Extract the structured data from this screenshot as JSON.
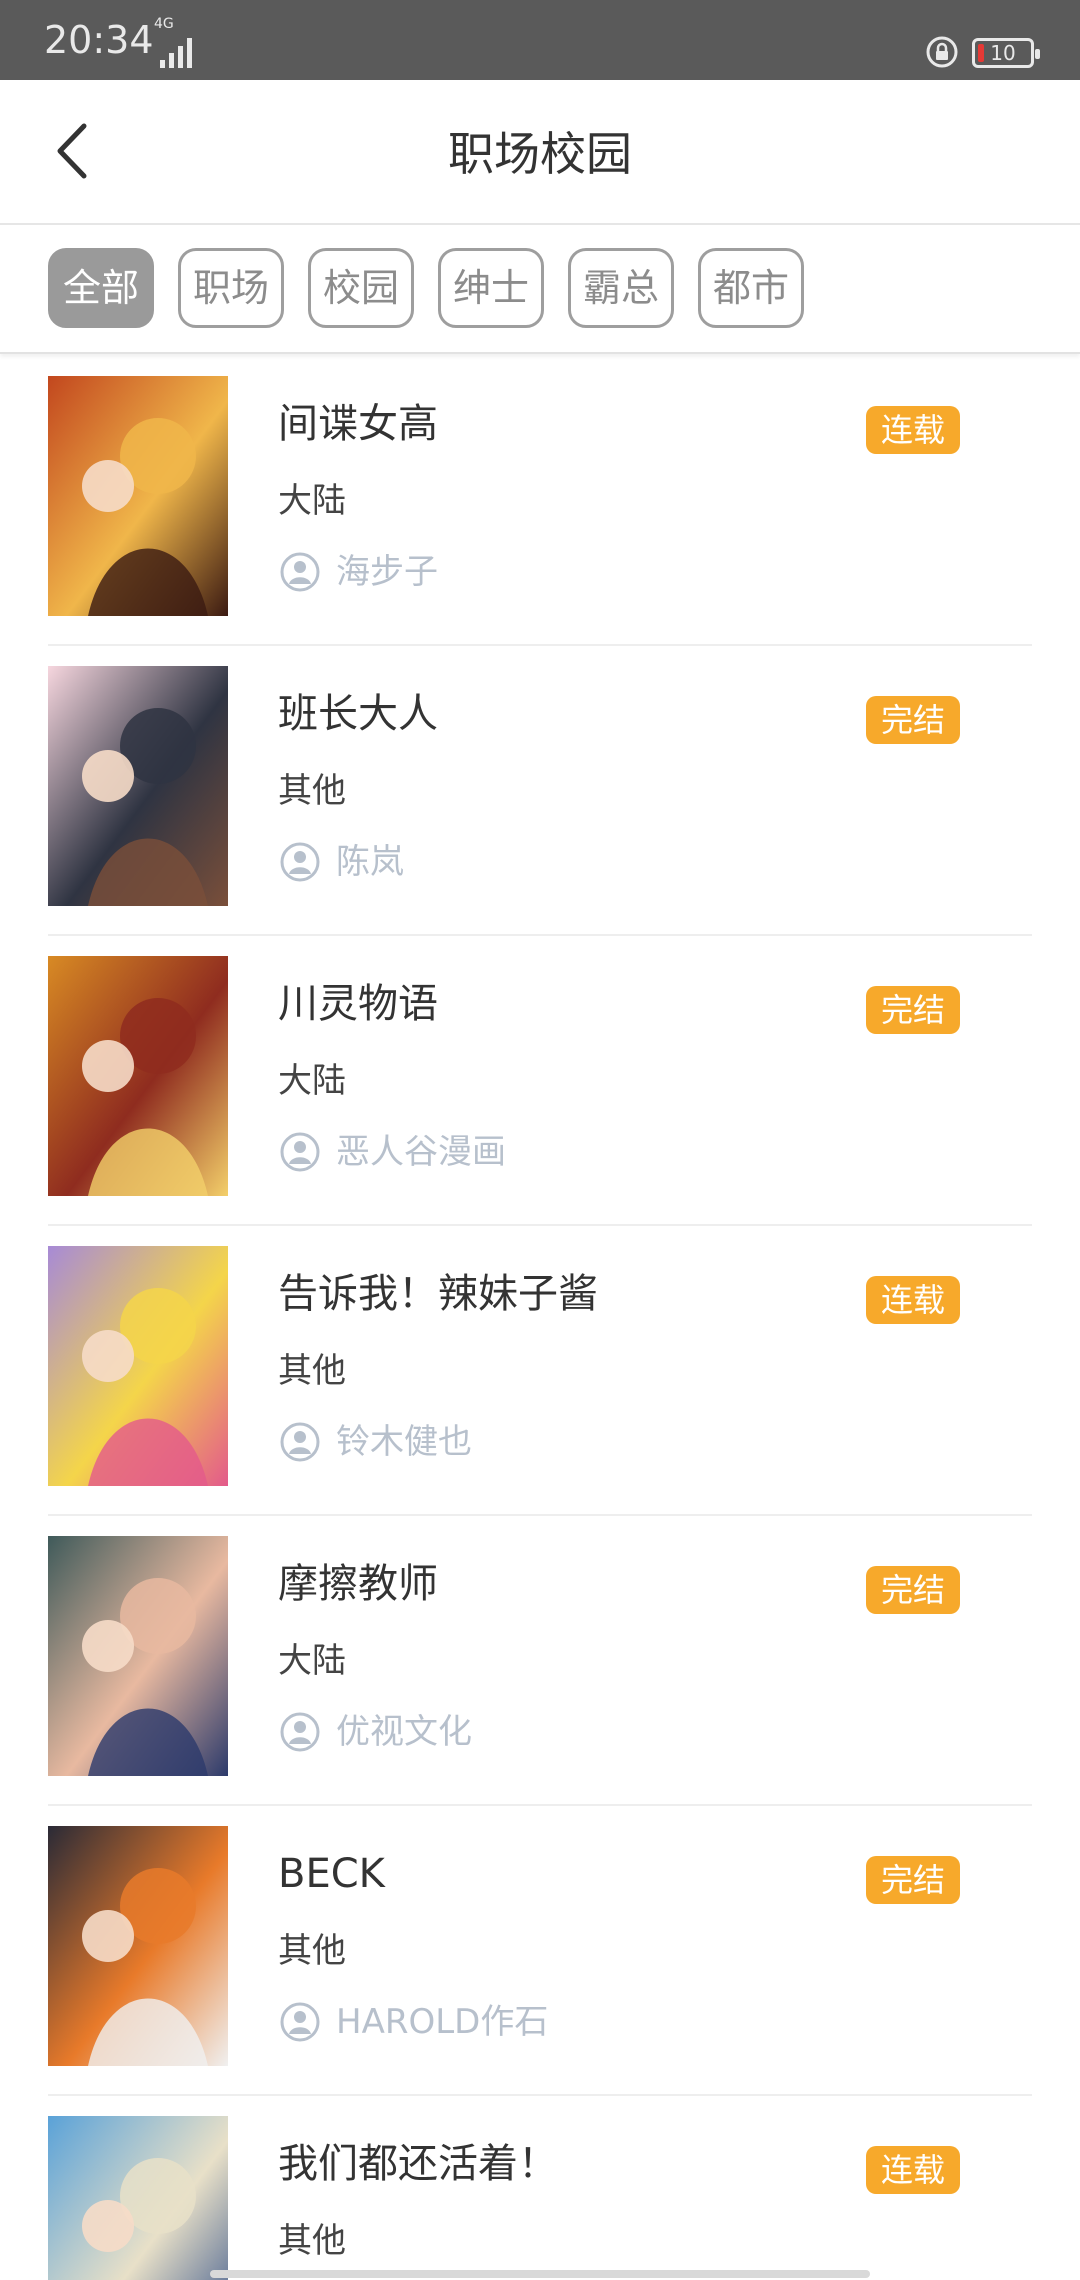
{
  "status_bar": {
    "time": "20:34",
    "network": "4G",
    "battery": "10",
    "battery_fraction": 0.1
  },
  "header": {
    "title": "职场校园",
    "back_icon": "chevron-left-icon"
  },
  "filters": [
    {
      "label": "全部",
      "active": true
    },
    {
      "label": "职场",
      "active": false
    },
    {
      "label": "校园",
      "active": false
    },
    {
      "label": "绅士",
      "active": false
    },
    {
      "label": "霸总",
      "active": false
    },
    {
      "label": "都市",
      "active": false
    }
  ],
  "comics": [
    {
      "title": "间谍女高",
      "status": "连载",
      "region": "大陆",
      "author": "海步子",
      "cover_colors": [
        "#c2471e",
        "#f0b64a",
        "#3b1a12"
      ]
    },
    {
      "title": "班长大人",
      "status": "完结",
      "region": "其他",
      "author": "陈岚",
      "cover_colors": [
        "#f6d6de",
        "#2f3442",
        "#7a4f3a"
      ]
    },
    {
      "title": "川灵物语",
      "status": "完结",
      "region": "大陆",
      "author": "恶人谷漫画",
      "cover_colors": [
        "#d88a24",
        "#8f2c1f",
        "#f3cf6a"
      ]
    },
    {
      "title": "告诉我！辣妹子酱",
      "status": "连载",
      "region": "其他",
      "author": "铃木健也",
      "cover_colors": [
        "#a78ad6",
        "#f4d54a",
        "#e35a8b"
      ]
    },
    {
      "title": "摩擦教师",
      "status": "完结",
      "region": "大陆",
      "author": "优视文化",
      "cover_colors": [
        "#3f5a5a",
        "#e8b9a0",
        "#2c3a6b"
      ]
    },
    {
      "title": "BECK",
      "status": "完结",
      "region": "其他",
      "author": "HAROLD作石",
      "cover_colors": [
        "#2a2a36",
        "#e87a2a",
        "#f0f0f0"
      ]
    },
    {
      "title": "我们都还活着！",
      "status": "连载",
      "region": "其他",
      "author": "",
      "cover_colors": [
        "#5aa2d8",
        "#e8e0c8",
        "#2b4a86"
      ]
    }
  ],
  "colors": {
    "status_badge": "#f7a92b",
    "author_text": "#b7c0cc",
    "active_tab": "#9a9a9a"
  }
}
